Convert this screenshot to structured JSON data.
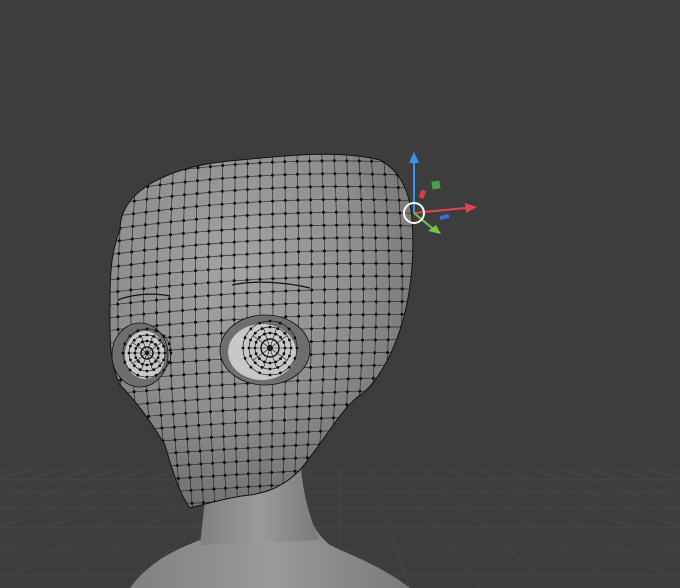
{
  "viewport": {
    "background": "#3d3d3d",
    "grid_color": "#454545",
    "mode": "Edit Mode",
    "shading": "Solid",
    "overlays": {
      "wireframe_edges": true,
      "vertex_dots": true
    }
  },
  "mesh": {
    "object": "head",
    "surface_color": "#8d8d8d",
    "edge_color": "#1a1a1a",
    "vertex_color": "#0d0d0d"
  },
  "gizmo": {
    "type": "transform-gizmo",
    "axes": [
      {
        "axis": "x",
        "color": "#e0454e",
        "icon": "arrow-right-icon"
      },
      {
        "axis": "y",
        "color": "#7ac24a",
        "icon": "arrow-down-left-icon"
      },
      {
        "axis": "z",
        "color": "#3d8ff0",
        "icon": "arrow-up-icon"
      }
    ],
    "plane_handles": [
      {
        "plane": "xz",
        "color": "#4aa04a"
      },
      {
        "plane": "yz",
        "color": "#d6404a"
      },
      {
        "plane": "xy",
        "color": "#3a70e0"
      }
    ],
    "pivot_color": "#ffffff"
  }
}
